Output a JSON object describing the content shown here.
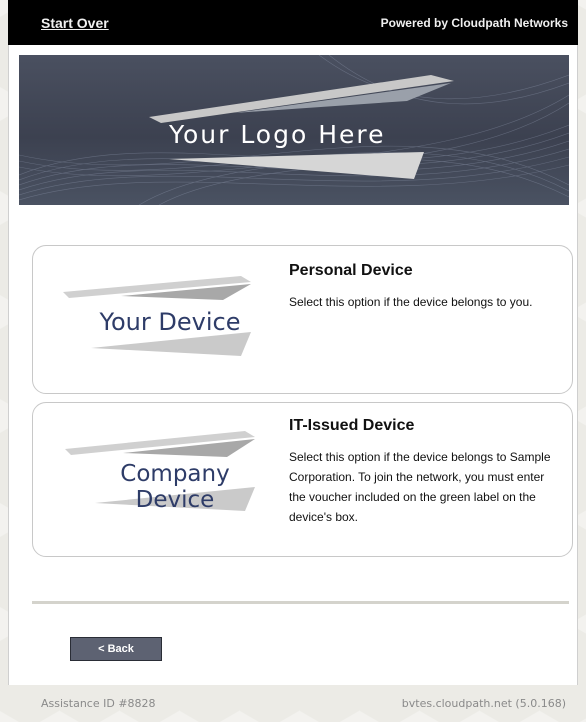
{
  "topbar": {
    "start_over": "Start Over",
    "powered_by": "Powered by Cloudpath Networks"
  },
  "banner": {
    "logo_text": "Your Logo Here"
  },
  "options": [
    {
      "logo_text": "Your Device",
      "title": "Personal Device",
      "description": "Select this option if the device belongs to you."
    },
    {
      "logo_text": "Company Device",
      "title": "IT-Issued Device",
      "description": "Select this option if the device belongs to Sample Corporation. To join the network, you must enter the voucher included on the green label on the device's box."
    }
  ],
  "back_button": "< Back",
  "footer": {
    "assistance_id": "Assistance ID #8828",
    "server": "bvtes.cloudpath.net (5.0.168)"
  },
  "colors": {
    "topbar": "#000000",
    "banner": "#3c4150",
    "logo_text": "#2e3c68",
    "button": "#5d6272"
  }
}
